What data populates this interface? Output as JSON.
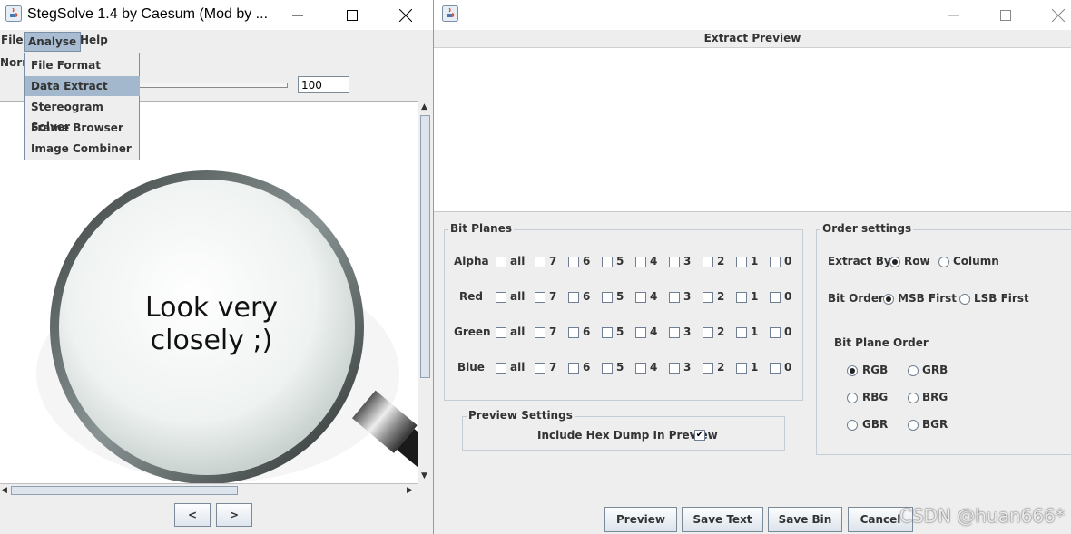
{
  "left_window": {
    "title": "StegSolve 1.4 by Caesum (Mod by ...",
    "menus": [
      "File",
      "Analyse",
      "Help"
    ],
    "analyse_menu_items": [
      "File Format",
      "Data Extract",
      "Stereogram Solver",
      "Frame Browser",
      "Image Combiner"
    ],
    "selected_menu_item": "Data Extract",
    "view_label_partial": "Norm",
    "zoom_value": "100",
    "image_text_line1": "Look very",
    "image_text_line2": "closely ;)",
    "prev_label": "<",
    "next_label": ">"
  },
  "right_window": {
    "preview_title": "Extract Preview",
    "bit_planes": {
      "title": "Bit Planes",
      "channels": [
        "Alpha",
        "Red",
        "Green",
        "Blue"
      ],
      "bits": [
        "all",
        "7",
        "6",
        "5",
        "4",
        "3",
        "2",
        "1",
        "0"
      ]
    },
    "order_settings": {
      "title": "Order settings",
      "extract_by_label": "Extract By",
      "extract_by_options": [
        "Row",
        "Column"
      ],
      "extract_by_selected": "Row",
      "bit_order_label": "Bit Order",
      "bit_order_options": [
        "MSB First",
        "LSB First"
      ],
      "bit_order_selected": "MSB First",
      "bit_plane_order_label": "Bit Plane Order",
      "bit_plane_order_options": [
        "RGB",
        "GRB",
        "RBG",
        "BRG",
        "GBR",
        "BGR"
      ],
      "bit_plane_order_selected": "RGB"
    },
    "preview_settings": {
      "title": "Preview Settings",
      "hex_dump_label": "Include Hex Dump In Preview",
      "hex_dump_checked": true
    },
    "buttons": [
      "Preview",
      "Save Text",
      "Save Bin",
      "Cancel"
    ]
  },
  "watermark": "CSDN @huan666*",
  "colors": {
    "menu_highlight": "#a3b8cc",
    "window_bg": "#eeeeee"
  }
}
